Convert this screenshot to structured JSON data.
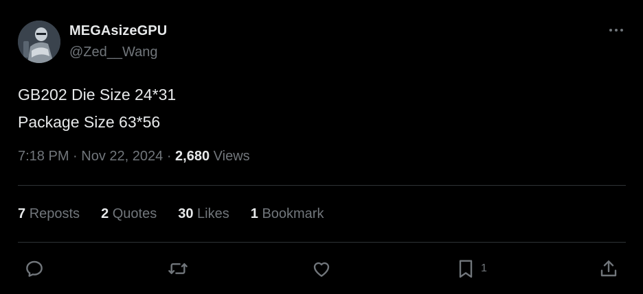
{
  "author": {
    "display_name": "MEGAsizeGPU",
    "handle": "@Zed__Wang"
  },
  "tweet": {
    "lines": [
      "GB202 Die Size 24*31",
      "Package Size 63*56"
    ],
    "time": "7:18 PM",
    "date": "Nov 22, 2024",
    "views_count": "2,680",
    "views_label": "Views"
  },
  "stats": [
    {
      "count": "7",
      "label": "Reposts"
    },
    {
      "count": "2",
      "label": "Quotes"
    },
    {
      "count": "30",
      "label": "Likes"
    },
    {
      "count": "1",
      "label": "Bookmark"
    }
  ],
  "actions": {
    "bookmark_count": "1",
    "icons": [
      "reply-icon",
      "repost-icon",
      "like-icon",
      "bookmark-icon",
      "share-icon"
    ]
  },
  "colors": {
    "background": "#000000",
    "primary_text": "#e7e9ea",
    "secondary_text": "#71767b",
    "divider": "#2f3336"
  }
}
